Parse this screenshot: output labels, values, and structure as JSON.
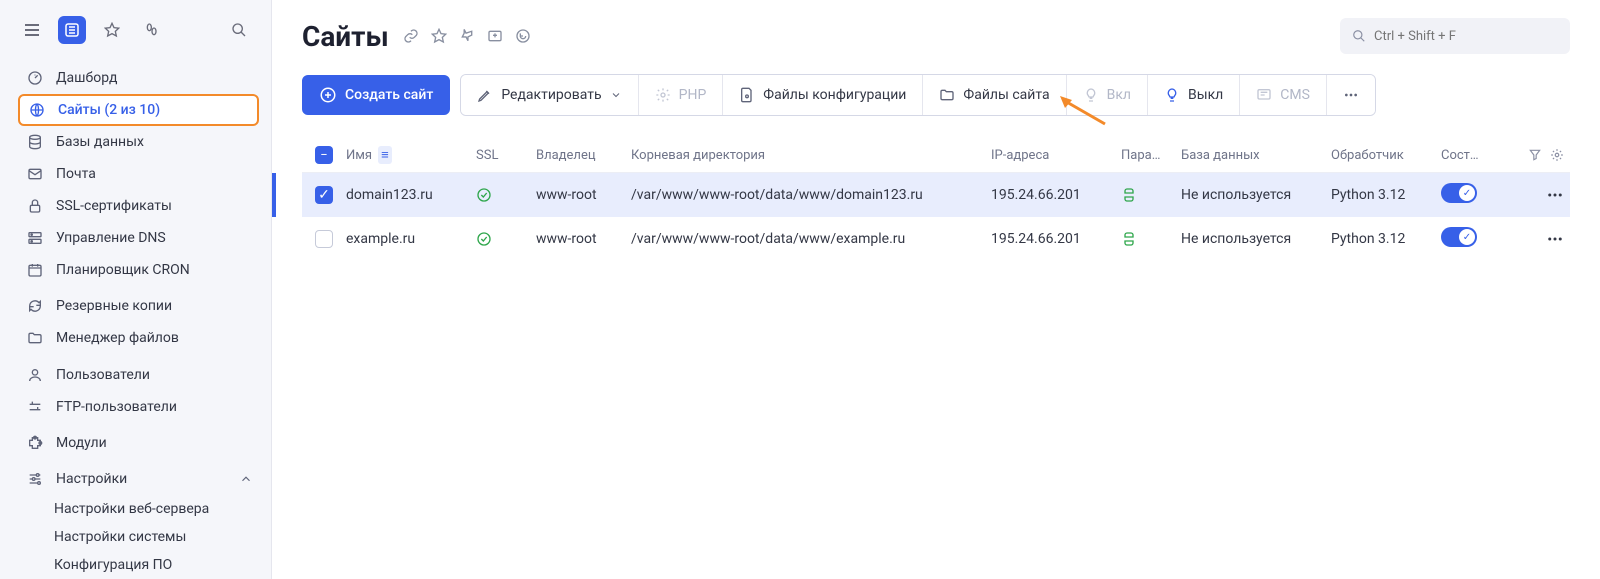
{
  "sidebar": {
    "items": [
      {
        "icon": "dashboard",
        "label": "Дашборд"
      },
      {
        "icon": "globe",
        "label": "Сайты (2 из 10)",
        "selected": true
      },
      {
        "icon": "database",
        "label": "Базы данных"
      },
      {
        "icon": "mail",
        "label": "Почта"
      },
      {
        "icon": "lock",
        "label": "SSL-сертификаты"
      },
      {
        "icon": "dns",
        "label": "Управление DNS"
      },
      {
        "icon": "calendar",
        "label": "Планировщик CRON"
      }
    ],
    "group2": [
      {
        "icon": "refresh",
        "label": "Резервные копии"
      },
      {
        "icon": "folder",
        "label": "Менеджер файлов"
      }
    ],
    "group3": [
      {
        "icon": "user",
        "label": "Пользователи"
      },
      {
        "icon": "ftp",
        "label": "FTP-пользователи"
      }
    ],
    "group4": [
      {
        "icon": "puzzle",
        "label": "Модули"
      }
    ],
    "settings": {
      "label": "Настройки",
      "children": [
        "Настройки веб-сервера",
        "Настройки системы",
        "Конфигурация ПО"
      ]
    }
  },
  "header": {
    "title": "Сайты",
    "search_placeholder": "Ctrl + Shift + F"
  },
  "toolbar": {
    "create": "Создать сайт",
    "edit": "Редактировать",
    "php": "PHP",
    "config": "Файлы конфигурации",
    "files": "Файлы сайта",
    "on": "Вкл",
    "off": "Выкл",
    "cms": "CMS"
  },
  "table": {
    "columns": {
      "name": "Имя",
      "ssl": "SSL",
      "owner": "Владелец",
      "root": "Корневая директория",
      "ip": "IP-адреса",
      "param": "Пара…",
      "db": "База данных",
      "handler": "Обработчик",
      "state": "Сост…"
    },
    "rows": [
      {
        "checked": true,
        "name": "domain123.ru",
        "owner": "www-root",
        "root": "/var/www/www-root/data/www/domain123.ru",
        "ip": "195.24.66.201",
        "db": "Не используется",
        "handler": "Python 3.12"
      },
      {
        "checked": false,
        "name": "example.ru",
        "owner": "www-root",
        "root": "/var/www/www-root/data/www/example.ru",
        "ip": "195.24.66.201",
        "db": "Не используется",
        "handler": "Python 3.12"
      }
    ]
  }
}
